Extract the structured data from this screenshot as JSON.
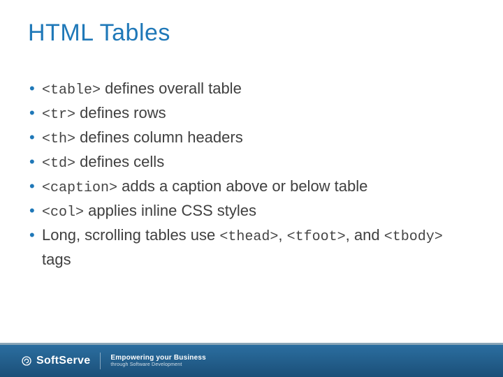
{
  "title": "HTML Tables",
  "bullets": [
    {
      "code": "<table>",
      "text": " defines overall table"
    },
    {
      "code": "<tr>",
      "text": " defines rows"
    },
    {
      "code": "<th>",
      "text": " defines column headers"
    },
    {
      "code": "<td>",
      "text": " defines cells"
    },
    {
      "code": "<caption>",
      "text": " adds a caption above or below table"
    },
    {
      "code": "<col>",
      "text": " applies inline CSS styles"
    }
  ],
  "lastBullet": {
    "prefix": "Long, scrolling tables use ",
    "code1": "<thead>",
    "mid1": ", ",
    "code2": "<tfoot>",
    "mid2": ", and ",
    "code3": "<tbody>",
    "suffix": " tags"
  },
  "footer": {
    "brand": "SoftServe",
    "taglineMain": "Empowering your Business",
    "taglineSub": "through Software Development"
  }
}
